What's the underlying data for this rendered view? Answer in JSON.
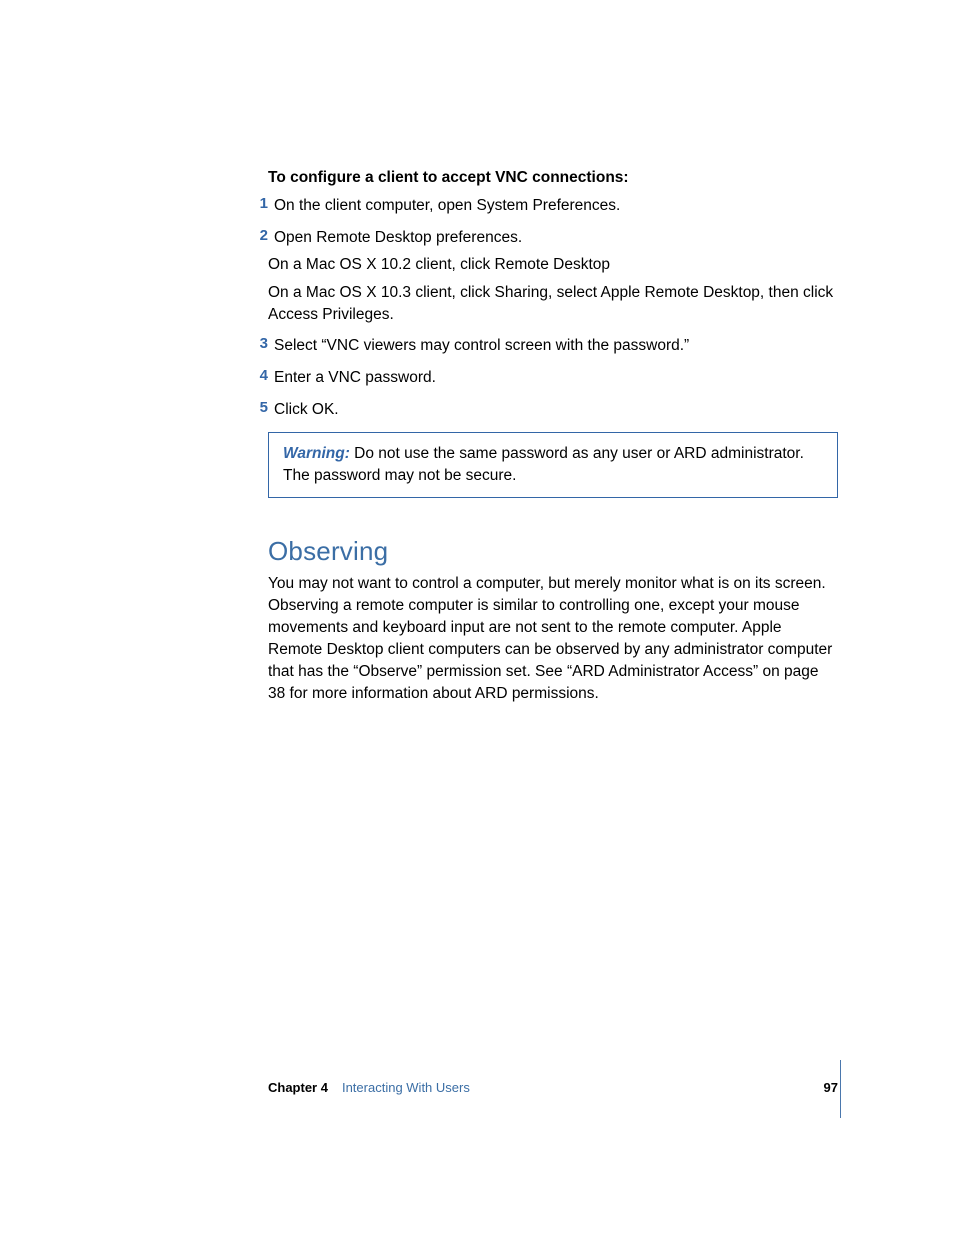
{
  "instruction": {
    "heading": "To configure a client to accept VNC connections:",
    "steps": [
      {
        "num": "1",
        "text": "On the client computer, open System Preferences.",
        "sub": []
      },
      {
        "num": "2",
        "text": "Open Remote Desktop preferences.",
        "sub": [
          "On a Mac OS X 10.2 client, click Remote Desktop",
          "On a Mac OS X 10.3 client, click Sharing, select Apple Remote Desktop, then click Access Privileges."
        ]
      },
      {
        "num": "3",
        "text": "Select “VNC viewers may control screen with the password.”",
        "sub": []
      },
      {
        "num": "4",
        "text": "Enter a VNC password.",
        "sub": []
      },
      {
        "num": "5",
        "text": "Click OK.",
        "sub": []
      }
    ]
  },
  "warning": {
    "label": "Warning:",
    "text": "  Do not use the same password as any user or ARD administrator. The password may not be secure."
  },
  "section": {
    "heading": "Observing",
    "body": "You may not want to control a computer, but merely monitor what is on its screen. Observing a remote computer is similar to controlling one, except your mouse movements and keyboard input are not sent to the remote computer. Apple Remote Desktop client computers can be observed by any administrator computer that has the “Observe” permission set. See “ARD Administrator Access” on page 38 for more information about ARD permissions."
  },
  "footer": {
    "chapter_label": "Chapter 4",
    "chapter_title": "Interacting With Users",
    "page_number": "97"
  }
}
